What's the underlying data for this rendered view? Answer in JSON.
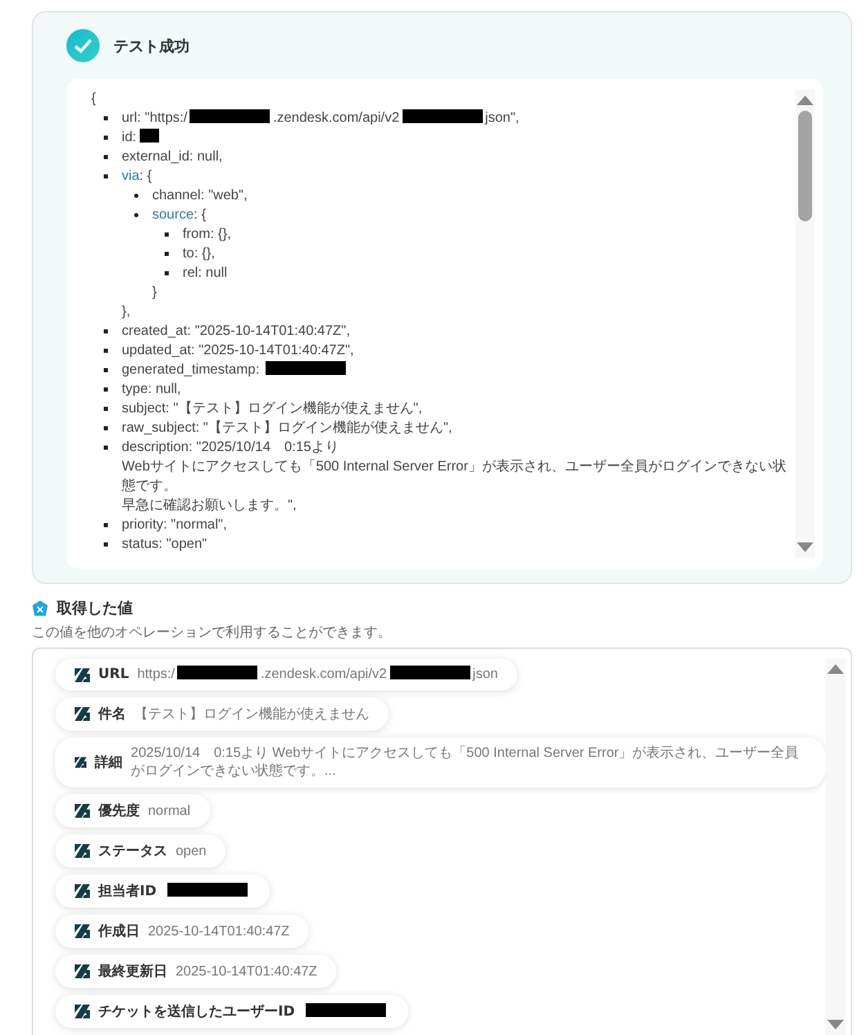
{
  "test_result": {
    "title": "テスト成功",
    "success": true,
    "lines": [
      {
        "kind": "brace",
        "parts": [
          {
            "kind": "text",
            "text": "{"
          }
        ],
        "children": [
          {
            "kind": "item",
            "parts": [
              {
                "kind": "text",
                "text": "url: \"https:/"
              },
              {
                "kind": "redacted"
              },
              {
                "kind": "text",
                "text": ".zendesk.com/api/v2"
              },
              {
                "kind": "redacted"
              },
              {
                "kind": "text",
                "text": "json\","
              }
            ]
          },
          {
            "kind": "item",
            "parts": [
              {
                "kind": "text",
                "text": "id:"
              },
              {
                "kind": "redacted_short"
              }
            ]
          },
          {
            "kind": "item",
            "parts": [
              {
                "kind": "text",
                "text": "external_id: null,"
              }
            ]
          },
          {
            "kind": "item",
            "parts": [
              {
                "kind": "key",
                "text": "via"
              },
              {
                "kind": "text",
                "text": ": {"
              }
            ],
            "children": [
              {
                "kind": "item",
                "parts": [
                  {
                    "kind": "text",
                    "text": "channel: \"web\","
                  }
                ]
              },
              {
                "kind": "item",
                "parts": [
                  {
                    "kind": "key",
                    "text": "source"
                  },
                  {
                    "kind": "text",
                    "text": ": {"
                  }
                ],
                "children": [
                  {
                    "kind": "item",
                    "parts": [
                      {
                        "kind": "text",
                        "text": "from: {},"
                      }
                    ]
                  },
                  {
                    "kind": "item",
                    "parts": [
                      {
                        "kind": "text",
                        "text": "to: {},"
                      }
                    ]
                  },
                  {
                    "kind": "item",
                    "parts": [
                      {
                        "kind": "text",
                        "text": "rel: null"
                      }
                    ]
                  }
                ]
              },
              {
                "kind": "brace",
                "parts": [
                  {
                    "kind": "text",
                    "text": "}"
                  }
                ]
              }
            ]
          },
          {
            "kind": "brace",
            "parts": [
              {
                "kind": "text",
                "text": "},"
              }
            ]
          },
          {
            "kind": "item",
            "parts": [
              {
                "kind": "text",
                "text": "created_at: \"2025-10-14T01:40:47Z\","
              }
            ]
          },
          {
            "kind": "item",
            "parts": [
              {
                "kind": "text",
                "text": "updated_at: \"2025-10-14T01:40:47Z\","
              }
            ]
          },
          {
            "kind": "item",
            "parts": [
              {
                "kind": "text",
                "text": "generated_timestamp: "
              },
              {
                "kind": "redacted"
              }
            ]
          },
          {
            "kind": "item",
            "parts": [
              {
                "kind": "text",
                "text": "type: null,"
              }
            ]
          },
          {
            "kind": "item",
            "parts": [
              {
                "kind": "text",
                "text": "subject: \"【テスト】ログイン機能が使えません\","
              }
            ]
          },
          {
            "kind": "item",
            "parts": [
              {
                "kind": "text",
                "text": "raw_subject: \"【テスト】ログイン機能が使えません\","
              }
            ]
          },
          {
            "kind": "item",
            "parts": [
              {
                "kind": "text",
                "text": "description: \"2025/10/14　0:15より"
              },
              {
                "kind": "break"
              },
              {
                "kind": "text",
                "text": "Webサイトにアクセスしても「500 Internal Server Error」が表示され、ユーザー全員がログインできない状態です。"
              },
              {
                "kind": "break"
              },
              {
                "kind": "text",
                "text": "早急に確認お願いします。\","
              }
            ]
          },
          {
            "kind": "item",
            "parts": [
              {
                "kind": "text",
                "text": "priority: \"normal\","
              }
            ]
          },
          {
            "kind": "item",
            "parts": [
              {
                "kind": "text",
                "text": "status: \"open\""
              }
            ]
          }
        ]
      }
    ]
  },
  "values_section": {
    "title": "取得した値",
    "description": "この値を他のオペレーションで利用することができます。",
    "fields": [
      {
        "label": "URL",
        "parts": [
          {
            "kind": "text",
            "text": "https:/"
          },
          {
            "kind": "redacted"
          },
          {
            "kind": "text",
            "text": ".zendesk.com/api/v2"
          },
          {
            "kind": "redacted"
          },
          {
            "kind": "text",
            "text": "json"
          }
        ]
      },
      {
        "label": "件名",
        "parts": [
          {
            "kind": "text",
            "text": "【テスト】ログイン機能が使えません"
          }
        ]
      },
      {
        "label": "詳細",
        "parts": [
          {
            "kind": "text",
            "text": "2025/10/14　0:15より Webサイトにアクセスしても「500 Internal Server Error」が表示され、ユーザー全員がログインできない状態です。..."
          }
        ]
      },
      {
        "label": "優先度",
        "parts": [
          {
            "kind": "text",
            "text": "normal"
          }
        ]
      },
      {
        "label": "ステータス",
        "parts": [
          {
            "kind": "text",
            "text": "open"
          }
        ]
      },
      {
        "label": "担当者ID",
        "parts": [
          {
            "kind": "redacted"
          }
        ]
      },
      {
        "label": "作成日",
        "parts": [
          {
            "kind": "text",
            "text": "2025-10-14T01:40:47Z"
          }
        ]
      },
      {
        "label": "最終更新日",
        "parts": [
          {
            "kind": "text",
            "text": "2025-10-14T01:40:47Z"
          }
        ]
      },
      {
        "label": "チケットを送信したユーザーID",
        "parts": [
          {
            "kind": "redacted"
          }
        ]
      }
    ]
  }
}
